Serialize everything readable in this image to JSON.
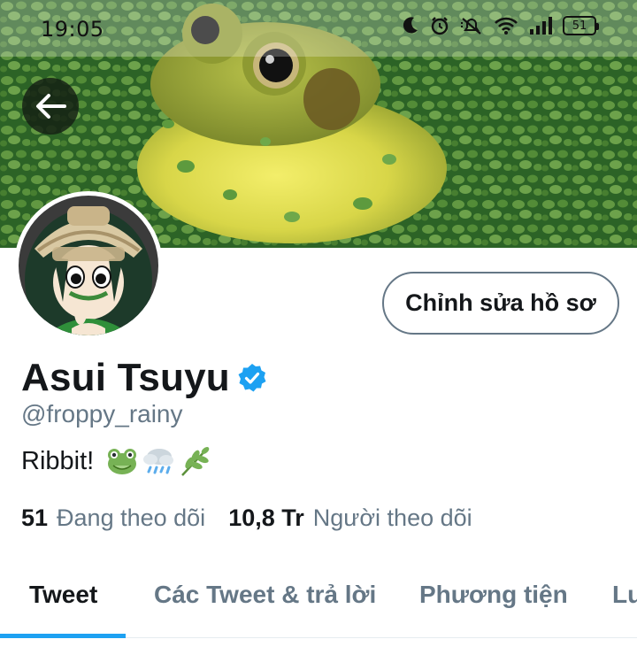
{
  "status_bar": {
    "time": "19:05",
    "battery": "51",
    "icons": [
      "moon-icon",
      "alarm-icon",
      "silent-icon",
      "wifi-icon",
      "signal-icon",
      "battery-icon"
    ]
  },
  "banner": {
    "description_icon": "frog-banner-image"
  },
  "header": {
    "back_icon": "back-arrow-icon"
  },
  "profile": {
    "display_name": "Asui Tsuyu",
    "verified": true,
    "handle": "@froppy_rainy",
    "bio_text": "Ribbit!",
    "bio_emojis": [
      "frog-emoji",
      "rain-cloud-emoji",
      "herb-emoji"
    ],
    "edit_button": "Chỉnh sửa hồ sơ",
    "following_count": "51",
    "following_label": "Đang theo dõi",
    "followers_count": "10,8 Tr",
    "followers_label": "Người theo dõi"
  },
  "tabs": [
    {
      "label": "Tweet",
      "active": true
    },
    {
      "label": "Các Tweet & trả lời",
      "active": false
    },
    {
      "label": "Phương tiện",
      "active": false
    },
    {
      "label": "Lư",
      "active": false
    }
  ],
  "colors": {
    "accent": "#1da1f2",
    "text_primary": "#14171a",
    "text_secondary": "#657786",
    "verified": "#1da1f2"
  }
}
